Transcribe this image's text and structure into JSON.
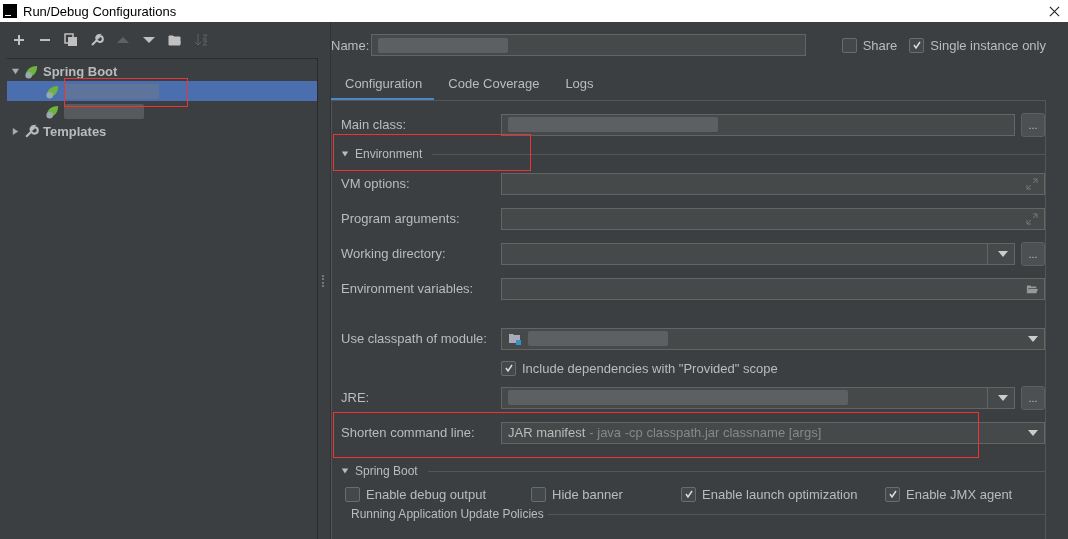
{
  "window": {
    "title": "Run/Debug Configurations"
  },
  "toolbar": [
    {
      "kind": "add",
      "disabled": false
    },
    {
      "kind": "remove",
      "disabled": false
    },
    {
      "kind": "copy",
      "disabled": false
    },
    {
      "kind": "wrench",
      "disabled": false
    },
    {
      "kind": "up",
      "disabled": true
    },
    {
      "kind": "down",
      "disabled": false
    },
    {
      "kind": "folder",
      "disabled": false
    },
    {
      "kind": "sort",
      "disabled": true
    }
  ],
  "tree": [
    {
      "label": "Spring Boot",
      "kind": "spring",
      "expanded": true,
      "children": [
        {
          "kind": "spring",
          "selected": true
        },
        {
          "kind": "spring",
          "selected": false
        }
      ]
    },
    {
      "label": "Templates",
      "kind": "wrench",
      "expanded": false
    }
  ],
  "name_field": {
    "label": "Name:"
  },
  "options": [
    {
      "label": "Share",
      "checked": false
    },
    {
      "label": "Single instance only",
      "checked": true
    }
  ],
  "tabs": [
    {
      "label": "Configuration",
      "selected": true
    },
    {
      "label": "Code Coverage",
      "selected": false
    },
    {
      "label": "Logs",
      "selected": false
    }
  ],
  "main_class": {
    "label": "Main class:",
    "browse": "..."
  },
  "environment": {
    "label": "Environment",
    "expanded": true
  },
  "fields": [
    {
      "kind": "expand",
      "label": "VM options:"
    },
    {
      "kind": "expand",
      "label": "Program arguments:"
    },
    {
      "kind": "combo-browse",
      "label": "Working directory:",
      "browse": "..."
    },
    {
      "kind": "folder",
      "label": "Environment variables:"
    },
    {
      "kind": "gap"
    },
    {
      "kind": "module",
      "label": "Use classpath of module:"
    },
    {
      "kind": "checkbox",
      "label": "Include dependencies with \"Provided\" scope",
      "checked": true
    },
    {
      "kind": "combo-browse",
      "label": "JRE:",
      "blurred": true,
      "browse": "..."
    },
    {
      "kind": "combo",
      "label": "Shorten command line:",
      "value": "JAR manifest",
      "hint": "- java -cp classpath.jar classname [args]"
    }
  ],
  "spring_boot": {
    "label": "Spring Boot",
    "expanded": true,
    "checkboxes": [
      {
        "label": "Enable debug output",
        "checked": false
      },
      {
        "label": "Hide banner",
        "checked": false
      },
      {
        "label": "Enable launch optimization",
        "checked": true
      },
      {
        "label": "Enable JMX agent",
        "checked": true
      }
    ],
    "subsection": "Running Application Update Policies"
  }
}
